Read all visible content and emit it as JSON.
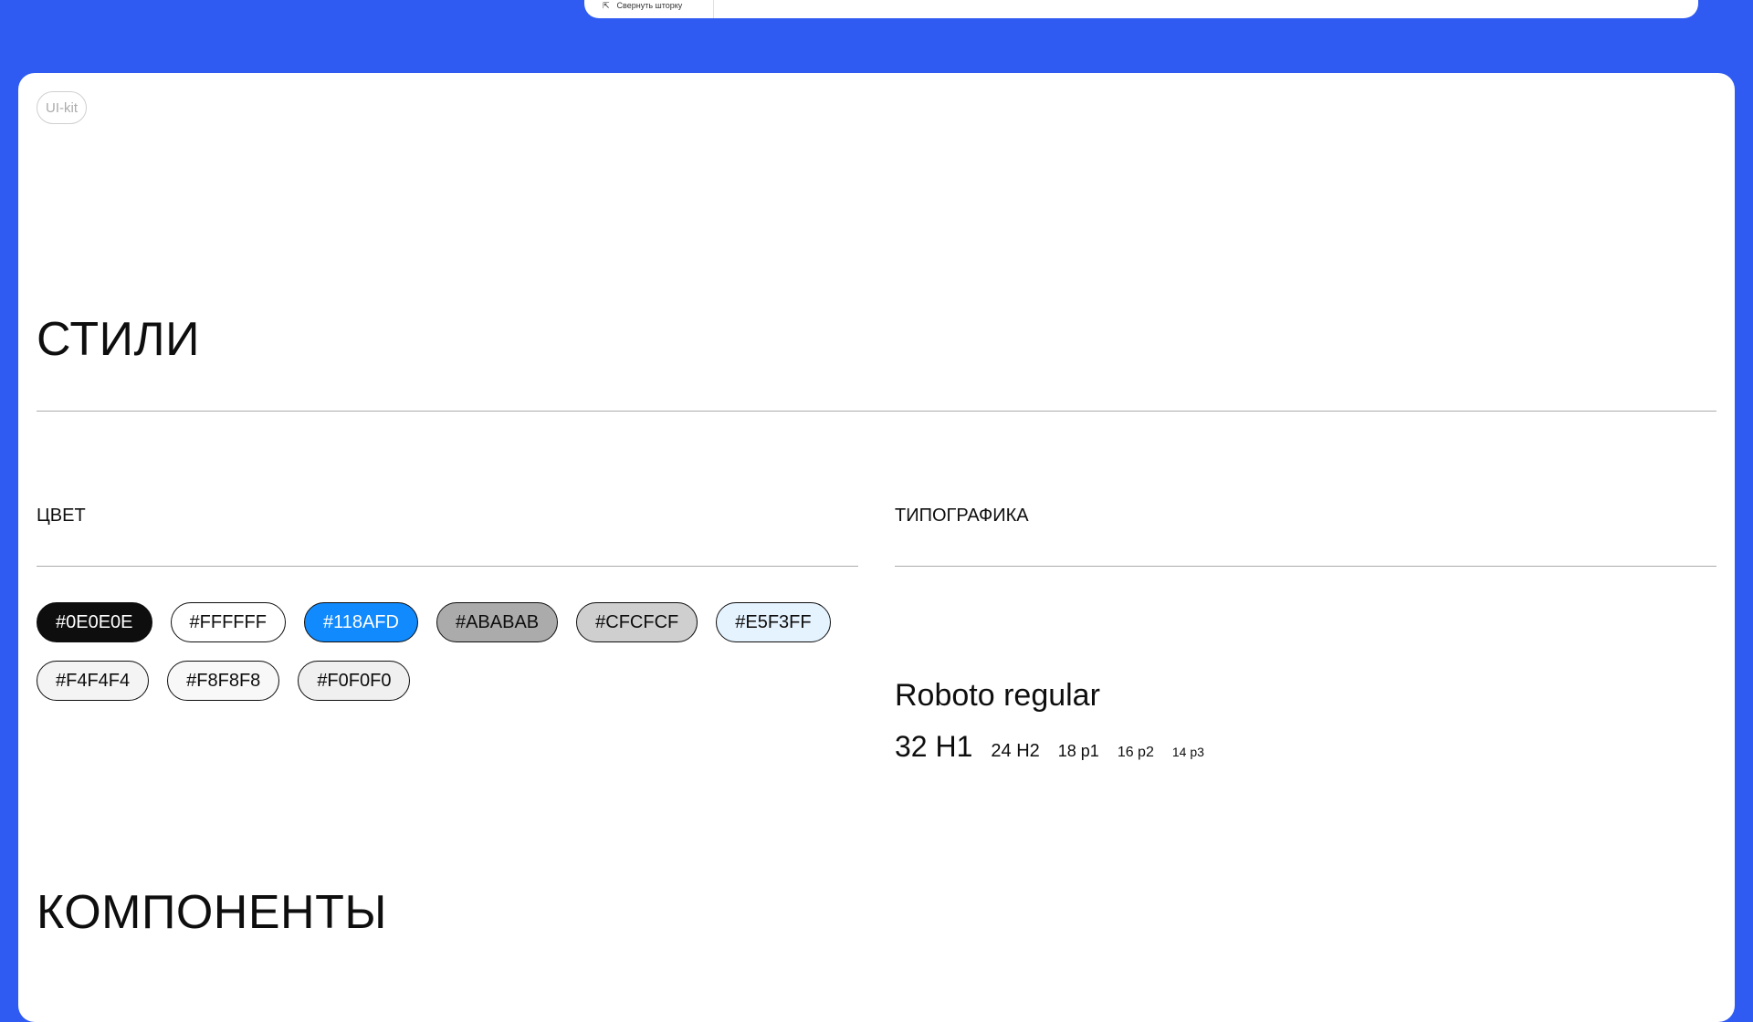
{
  "topbar": {
    "collapse_label": "Свернуть шторку",
    "collapse_icon": "collapse-icon"
  },
  "badge": {
    "label": "UI-kit"
  },
  "styles": {
    "title": "СТИЛИ",
    "color_heading": "ЦВЕТ",
    "typography_heading": "ТИПОГРАФИКА"
  },
  "colors": [
    {
      "label": "#0E0E0E",
      "bg": "#0E0E0E",
      "fg": "#FFFFFF",
      "border": "#0E0E0E"
    },
    {
      "label": "#FFFFFF",
      "bg": "#FFFFFF",
      "fg": "#0E0E0E",
      "border": "#0E0E0E"
    },
    {
      "label": "#118AFD",
      "bg": "#118AFD",
      "fg": "#FFFFFF",
      "border": "#0E0E0E"
    },
    {
      "label": "#ABABAB",
      "bg": "#ABABAB",
      "fg": "#0E0E0E",
      "border": "#0E0E0E"
    },
    {
      "label": "#CFCFCF",
      "bg": "#CFCFCF",
      "fg": "#0E0E0E",
      "border": "#0E0E0E"
    },
    {
      "label": "#E5F3FF",
      "bg": "#E5F3FF",
      "fg": "#0E0E0E",
      "border": "#0E0E0E"
    },
    {
      "label": "#F4F4F4",
      "bg": "#F4F4F4",
      "fg": "#0E0E0E",
      "border": "#0E0E0E"
    },
    {
      "label": "#F8F8F8",
      "bg": "#F8F8F8",
      "fg": "#0E0E0E",
      "border": "#0E0E0E"
    },
    {
      "label": "#F0F0F0",
      "bg": "#F0F0F0",
      "fg": "#0E0E0E",
      "border": "#0E0E0E"
    }
  ],
  "typography": {
    "family": "Roboto regular",
    "samples": {
      "h1": "32 H1",
      "h2": "24 H2",
      "p1": "18 p1",
      "p2": "16 p2",
      "p3": "14 p3"
    }
  },
  "components": {
    "title": "КОМПОНЕНТЫ"
  },
  "theme": {
    "page_bg": "#2F5BF2",
    "panel_bg": "#FFFFFF",
    "text": "#0E0E0E",
    "rule": "#ABABAB"
  }
}
